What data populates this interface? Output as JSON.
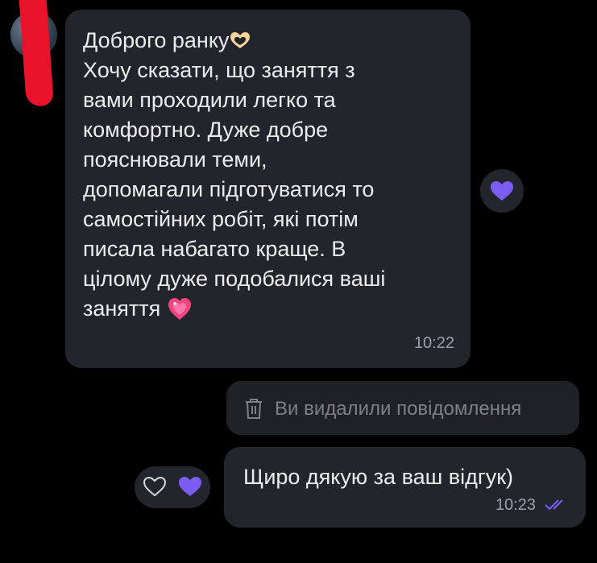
{
  "incoming_message": {
    "text": "Доброго ранку\nХочу сказати, що заняття з вами проходили легко та комфортно. Дуже добре пояснювали теми, допомагали підготуватися то самостійних робіт, які потім писала набагато краще. В цілому дуже подобалися ваші заняття",
    "line1": "Доброго ранку",
    "body": "Хочу сказати, що заняття з\nвами проходили легко та\nкомфортно. Дуже добре\nпояснювали теми,\nдопомагали підготуватися то\nсамостійних робіт, які потім\nписала набагато краще. В\nцілому дуже подобалися ваші\nзаняття",
    "time": "10:22",
    "reaction": "purple-heart"
  },
  "deleted_message": {
    "text": "Ви видалили повідомлення",
    "icon": "trash-icon"
  },
  "outgoing_message": {
    "text": "Щиро дякую за ваш відгук)",
    "time": "10:23",
    "status": "read",
    "reactions": [
      "heart-outline",
      "purple-heart"
    ]
  },
  "colors": {
    "background": "#000000",
    "bubble": "#22252b",
    "accent": "#7b5cf5",
    "redaction": "#e8132a",
    "muted_text": "#7c8189"
  }
}
